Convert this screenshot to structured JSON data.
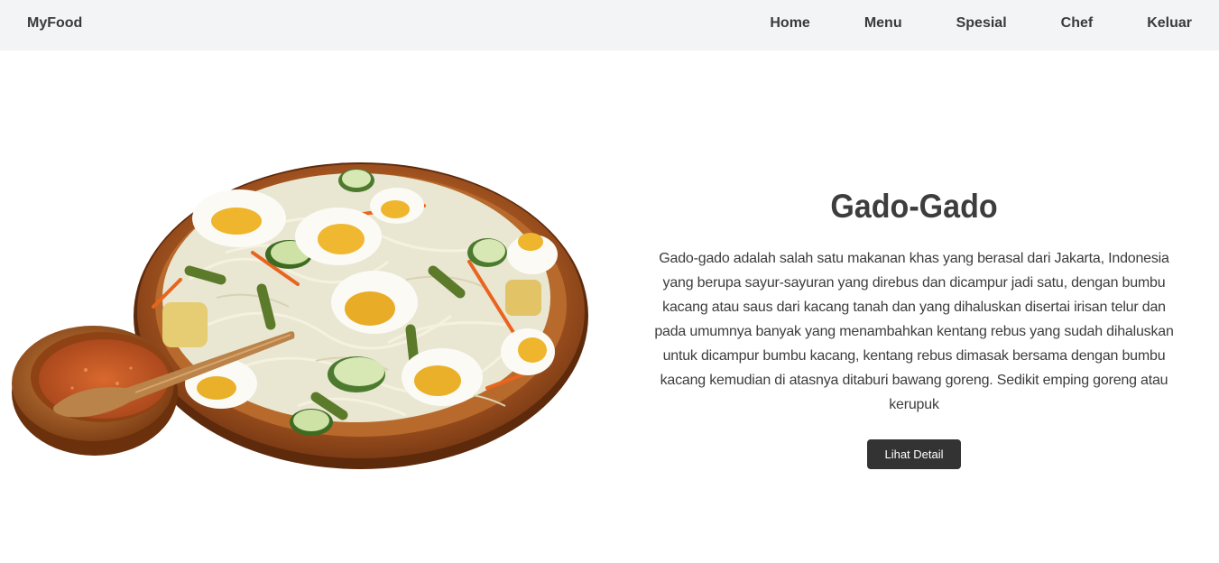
{
  "navbar": {
    "brand": "MyFood",
    "links": [
      "Home",
      "Menu",
      "Spesial",
      "Chef",
      "Keluar"
    ]
  },
  "hero": {
    "image_icon": "gado-gado-dish-image",
    "title": "Gado-Gado",
    "description": "Gado-gado adalah salah satu makanan khas yang berasal dari Jakarta, Indonesia yang berupa sayur-sayuran yang direbus dan dicampur jadi satu, dengan bumbu kacang atau saus dari kacang tanah dan yang dihaluskan disertai irisan telur dan pada umumnya banyak yang menambahkan kentang rebus yang sudah dihaluskan untuk dicampur bumbu kacang, kentang rebus dimasak bersama dengan bumbu kacang kemudian di atasnya ditaburi bawang goreng. Sedikit emping goreng atau kerupuk",
    "button_label": "Lihat Detail"
  },
  "colors": {
    "navbar_bg": "#f3f4f6",
    "text": "#3a3a3a",
    "button_bg": "#333333",
    "button_text": "#ffffff"
  }
}
